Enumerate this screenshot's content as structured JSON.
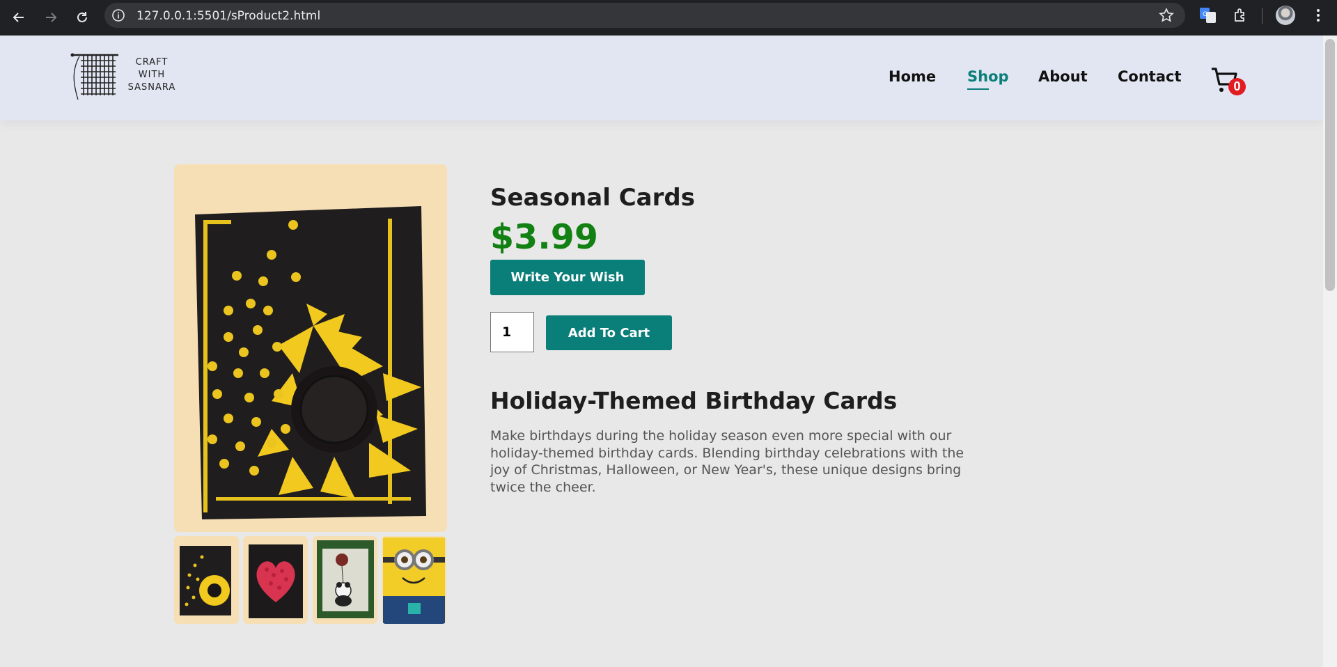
{
  "browser": {
    "url": "127.0.0.1:5501/sProduct2.html",
    "icons": [
      "back-icon",
      "forward-icon",
      "reload-icon",
      "site-info-icon",
      "bookmark-star-icon",
      "translate-icon",
      "extensions-icon",
      "profile-avatar",
      "more-menu-icon"
    ]
  },
  "site": {
    "logo_lines": [
      "CRAFT",
      "WITH",
      "SASNARA"
    ],
    "nav": [
      {
        "label": "Home",
        "active": false
      },
      {
        "label": "Shop",
        "active": true
      },
      {
        "label": "About",
        "active": false
      },
      {
        "label": "Contact",
        "active": false
      }
    ],
    "cart_count": "0",
    "accent_color": "#0a7e78",
    "badge_color": "#e11d22"
  },
  "product": {
    "title": "Seasonal Cards",
    "price": "$3.99",
    "price_color": "#128012",
    "wish_label": "Write Your Wish",
    "quantity": "1",
    "add_to_cart_label": "Add To Cart",
    "heading": "Holiday-Themed Birthday Cards",
    "description": "Make birthdays during the holiday season even more special with our holiday-themed birthday cards. Blending birthday celebrations with the joy of Christmas, Halloween, or New Year's, these unique designs bring twice the cheer.",
    "main_image": "sunflower-butterfly-card",
    "thumbnails": [
      "sunflower-butterfly-card",
      "red-rose-heart-card",
      "panda-balloon-card",
      "minion-card"
    ]
  }
}
